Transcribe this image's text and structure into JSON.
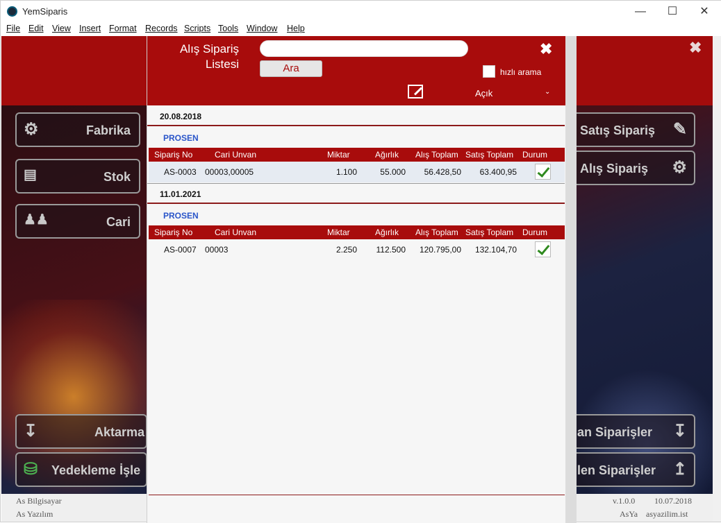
{
  "window": {
    "title": "YemSiparis"
  },
  "menu": [
    "File",
    "Edit",
    "View",
    "Insert",
    "Format",
    "Records",
    "Scripts",
    "Tools",
    "Window",
    "Help"
  ],
  "background": {
    "tiles_left": [
      "Fabrika",
      "Stok",
      "Cari",
      "Aktarma",
      "Yedekleme İşle"
    ],
    "tiles_right": [
      "Satış Sipariş",
      "Alış Sipariş",
      "an Siparişler",
      "len Siparişler"
    ],
    "footer": {
      "left1": "As Bilgisayar",
      "left2": "As Yazılım",
      "version": "v.1.0.0",
      "date": "10.07.2018",
      "brand": "AsYa",
      "site": "asyazilim.ist"
    }
  },
  "modal": {
    "title_line1": "Alış Sipariş",
    "title_line2": "Listesi",
    "search": {
      "value": "",
      "placeholder": ""
    },
    "search_button": "Ara",
    "quick_search_label": "hızlı arama",
    "quick_search_checked": false,
    "status": "Açık",
    "columns": [
      "Sipariş No",
      "Cari Unvan",
      "Miktar",
      "Ağırlık",
      "Alış Toplam",
      "Satış Toplam",
      "Durum"
    ],
    "groups": [
      {
        "date": "20.08.2018",
        "company": "PROSEN",
        "rows": [
          {
            "no": "AS-0003",
            "cari": "00003,00005",
            "miktar": "1.100",
            "agirlik": "55.000",
            "alis": "56.428,50",
            "satis": "63.400,95",
            "durum": true
          }
        ]
      },
      {
        "date": "11.01.2021",
        "company": "PROSEN",
        "rows": [
          {
            "no": "AS-0007",
            "cari": "00003",
            "miktar": "2.250",
            "agirlik": "112.500",
            "alis": "120.795,00",
            "satis": "132.104,70",
            "durum": true
          }
        ]
      }
    ]
  },
  "colors": {
    "brand_red": "#a80c0c",
    "company_blue": "#2a55c9",
    "check_green": "#2f8a1f"
  }
}
